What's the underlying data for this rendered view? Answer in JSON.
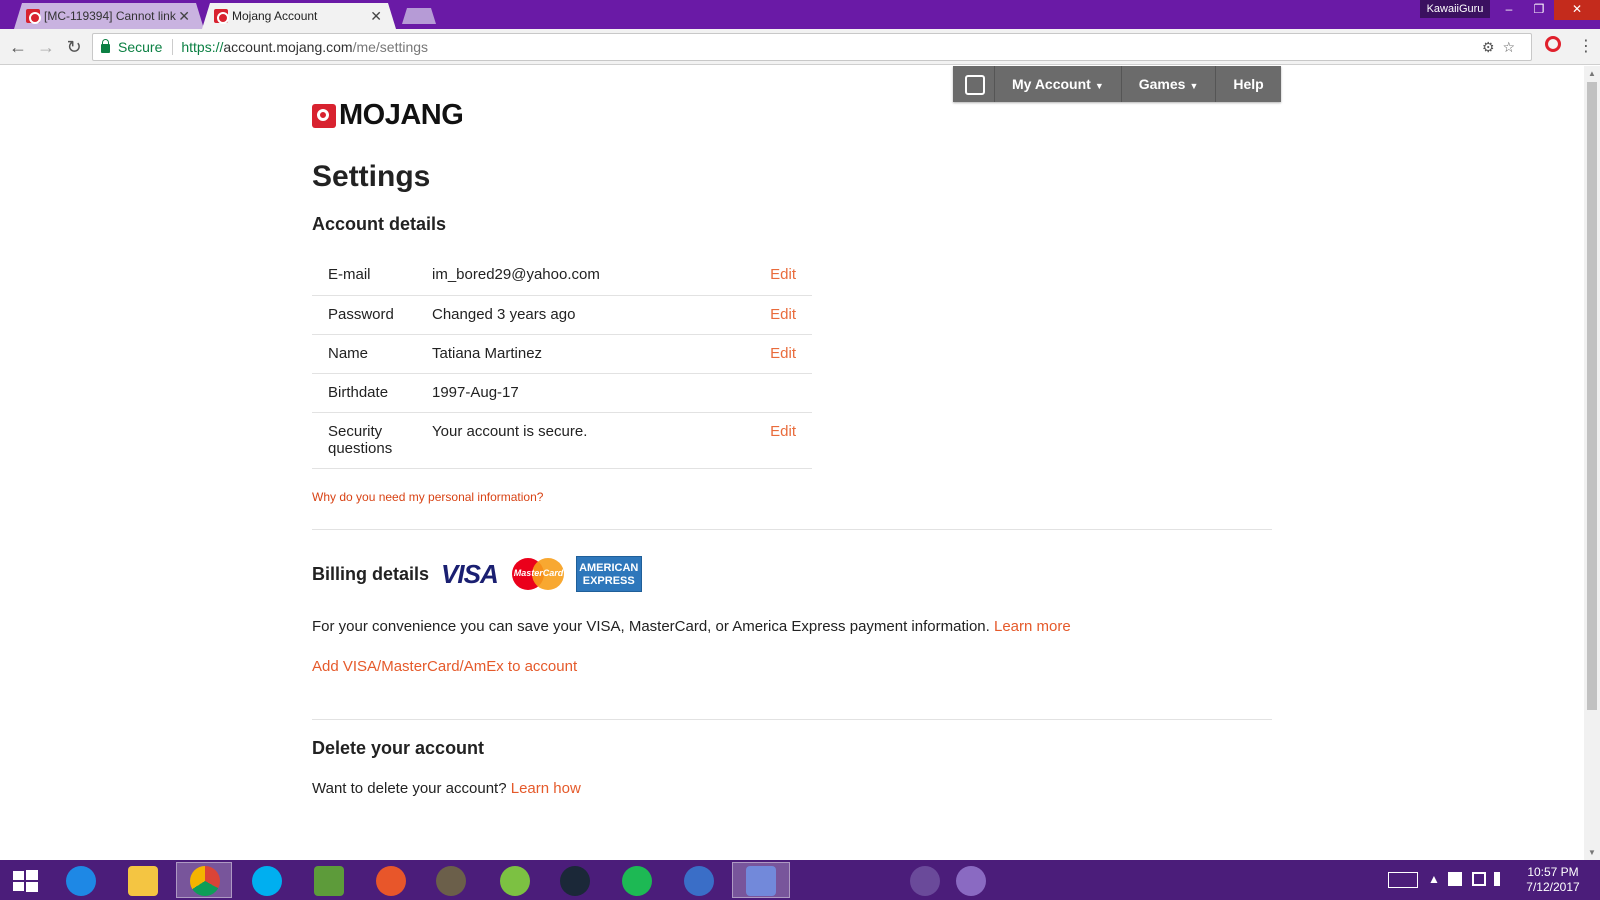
{
  "browser": {
    "tabs": [
      {
        "label": "[MC-119394] Cannot link",
        "close": "✕"
      },
      {
        "label": "Mojang Account",
        "close": "✕"
      }
    ],
    "user": "KawaiiGuru",
    "window_buttons": {
      "min": "–",
      "max": "❐",
      "close": "✕"
    },
    "nav": {
      "back": "←",
      "forward": "→",
      "reload": "↻"
    },
    "secure_label": "Secure",
    "url_proto": "https://",
    "url_host": "account.mojang.com",
    "url_path": "/me/settings",
    "omni_icons": "⚙☆",
    "menu": "⋮"
  },
  "site_nav": {
    "items": [
      "My Account",
      "Games",
      "Help"
    ],
    "caret": "▼"
  },
  "logo_text": "MOJANG",
  "page_title": "Settings",
  "account": {
    "heading": "Account details",
    "rows": [
      {
        "label": "E-mail",
        "value": "im_bored29@yahoo.com",
        "action": "Edit"
      },
      {
        "label": "Password",
        "value": "Changed 3 years ago",
        "action": "Edit"
      },
      {
        "label": "Name",
        "value": "Tatiana Martinez",
        "action": "Edit"
      },
      {
        "label": "Birthdate",
        "value": "1997-Aug-17",
        "action": ""
      },
      {
        "label": "Security questions",
        "value": "Your account is secure.",
        "action": "Edit"
      }
    ],
    "why_link": "Why do you need my personal information?"
  },
  "billing": {
    "heading": "Billing details",
    "visa": "VISA",
    "mastercard": "MasterCard",
    "amex_line1": "AMERICAN",
    "amex_line2": "EXPRESS",
    "text": "For your convenience you can save your VISA, MasterCard, or America Express payment information.",
    "learn_more": "Learn more",
    "add_link": "Add VISA/MasterCard/AmEx to account"
  },
  "delete": {
    "heading": "Delete your account",
    "text": "Want to delete your account?",
    "link": "Learn how"
  },
  "taskbar": {
    "time": "10:57 PM",
    "date": "7/12/2017",
    "tray_up": "▲"
  },
  "colors": {
    "accent": "#e96b3b",
    "link": "#e55a2b",
    "brand_red": "#d8222f",
    "taskbar": "#4b1d7a",
    "titlebar": "#6a1aa6"
  }
}
